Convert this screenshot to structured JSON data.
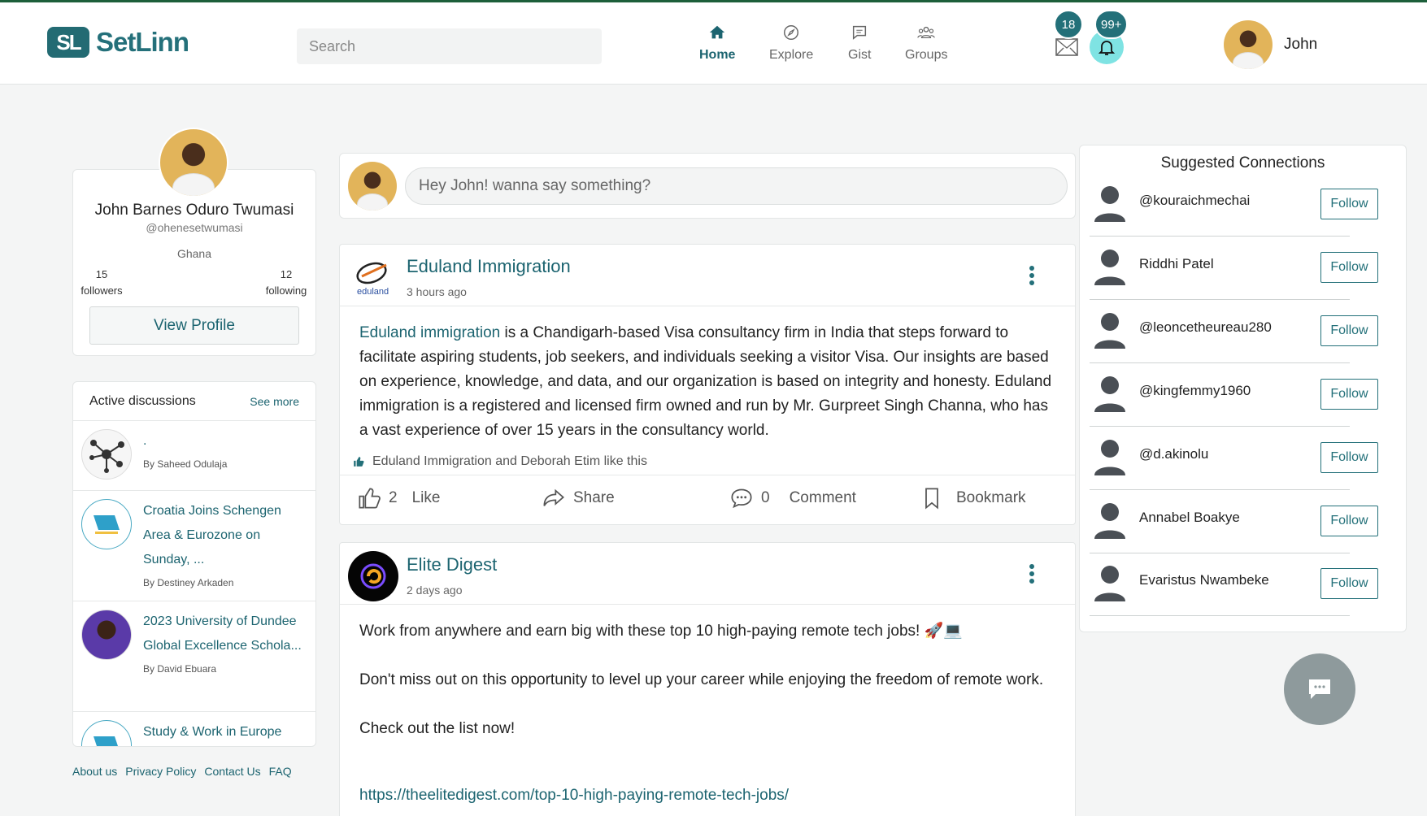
{
  "header": {
    "logo_mark": "SL",
    "logo_text": "SetLinn",
    "search_placeholder": "Search",
    "nav": [
      {
        "label": "Home",
        "icon": "home-icon",
        "active": true
      },
      {
        "label": "Explore",
        "icon": "compass-icon",
        "active": false
      },
      {
        "label": "Gist",
        "icon": "chat-icon",
        "active": false
      },
      {
        "label": "Groups",
        "icon": "groups-icon",
        "active": false
      }
    ],
    "messages_badge": "18",
    "notifications_badge": "99+",
    "user_name": "John"
  },
  "profile": {
    "name": "John Barnes Oduro Twumasi",
    "handle": "@ohenesetwumasi",
    "country": "Ghana",
    "followers_count": "15",
    "followers_label": "followers",
    "following_count": "12",
    "following_label": "following",
    "view_profile_label": "View Profile"
  },
  "discussions": {
    "title": "Active discussions",
    "see_more": "See more",
    "items": [
      {
        "title": ".",
        "by": "By Saheed Odulaja"
      },
      {
        "title": "Croatia Joins Schengen Area & Eurozone on Sunday, ...",
        "by": "By Destiney Arkaden"
      },
      {
        "title": "2023 University of Dundee Global Excellence Schola...",
        "by": "By David Ebuara"
      },
      {
        "title": "Study & Work in Europe",
        "by": ""
      }
    ]
  },
  "footer_links": [
    "About us",
    "Privacy Policy",
    "Contact Us",
    "FAQ"
  ],
  "compose": {
    "placeholder": "Hey John! wanna say something?"
  },
  "posts": [
    {
      "author": "Eduland Immigration",
      "logo_text": "eduland",
      "time": "3 hours ago",
      "body_link": "Eduland immigration",
      "body": " is a Chandigarh-based Visa consultancy firm in India that steps forward to facilitate aspiring students, job seekers, and individuals seeking a visitor Visa. Our insights are based on experience, knowledge, and data, and our organization is based on integrity and honesty. Eduland immigration is a registered and licensed firm owned and run by Mr. Gurpreet Singh Channa, who has a vast experience of over 15 years in the consultancy world.",
      "likes_text": "Eduland Immigration and Deborah Etim like this",
      "like_count": "2",
      "like_label": "Like",
      "share_label": "Share",
      "comment_count": "0",
      "comment_label": "Comment",
      "bookmark_label": "Bookmark"
    },
    {
      "author": "Elite Digest",
      "time": "2 days ago",
      "line1": "Work from anywhere and earn big with these top 10 high-paying remote tech jobs! 🚀💻",
      "line2": "Don't miss out on this opportunity to level up your career while enjoying the freedom of remote work.",
      "line3": "Check out the list now!",
      "url": "https://theelitedigest.com/top-10-high-paying-remote-tech-jobs/"
    }
  ],
  "suggestions": {
    "title": "Suggested Connections",
    "follow_label": "Follow",
    "people": [
      "@kouraichmechai",
      "Riddhi Patel",
      "@leoncetheureau280",
      "@kingfemmy1960",
      "@d.akinolu",
      "Annabel Boakye",
      "Evaristus Nwambeke"
    ]
  },
  "colors": {
    "brand": "#237079",
    "accent_bell": "#7fe3e3",
    "top_border": "#1d5f3a"
  }
}
